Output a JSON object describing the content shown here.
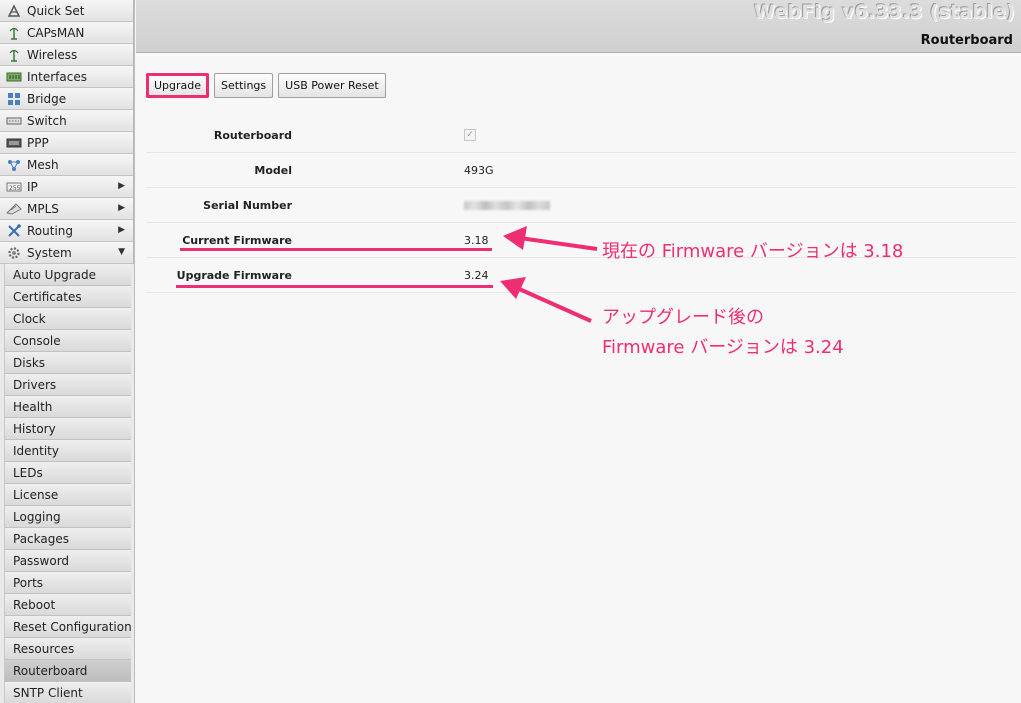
{
  "app": {
    "title": "WebFig v6.33.3 (stable)",
    "page_title": "Routerboard"
  },
  "sidebar": {
    "items": [
      {
        "label": "Quick Set",
        "icon": "quick-set-icon",
        "arrow": ""
      },
      {
        "label": "CAPsMAN",
        "icon": "antenna-icon",
        "arrow": ""
      },
      {
        "label": "Wireless",
        "icon": "antenna-icon",
        "arrow": ""
      },
      {
        "label": "Interfaces",
        "icon": "interfaces-icon",
        "arrow": ""
      },
      {
        "label": "Bridge",
        "icon": "bridge-icon",
        "arrow": ""
      },
      {
        "label": "Switch",
        "icon": "switch-icon",
        "arrow": ""
      },
      {
        "label": "PPP",
        "icon": "ppp-icon",
        "arrow": ""
      },
      {
        "label": "Mesh",
        "icon": "mesh-icon",
        "arrow": ""
      },
      {
        "label": "IP",
        "icon": "ip-icon",
        "arrow": "▶"
      },
      {
        "label": "MPLS",
        "icon": "mpls-icon",
        "arrow": "▶"
      },
      {
        "label": "Routing",
        "icon": "routing-icon",
        "arrow": "▶"
      },
      {
        "label": "System",
        "icon": "gear-icon",
        "arrow": "▼"
      }
    ],
    "sub_items": [
      "Auto Upgrade",
      "Certificates",
      "Clock",
      "Console",
      "Disks",
      "Drivers",
      "Health",
      "History",
      "Identity",
      "LEDs",
      "License",
      "Logging",
      "Packages",
      "Password",
      "Ports",
      "Reboot",
      "Reset Configuration",
      "Resources",
      "Routerboard",
      "SNTP Client"
    ],
    "active_sub_item": "Routerboard"
  },
  "toolbar": {
    "upgrade_label": "Upgrade",
    "settings_label": "Settings",
    "usb_power_reset_label": "USB Power Reset"
  },
  "form": {
    "routerboard_label": "Routerboard",
    "routerboard_checked": true,
    "model_label": "Model",
    "model_value": "493G",
    "serial_label": "Serial Number",
    "current_firmware_label": "Current Firmware",
    "current_firmware_value": "3.18",
    "upgrade_firmware_label": "Upgrade Firmware",
    "upgrade_firmware_value": "3.24"
  },
  "annotations": {
    "current": "現在の Firmware バージョンは 3.18",
    "upgrade_line1": "アップグレード後の",
    "upgrade_line2": "Firmware バージョンは 3.24"
  },
  "colors": {
    "accent": "#ee2e74"
  }
}
